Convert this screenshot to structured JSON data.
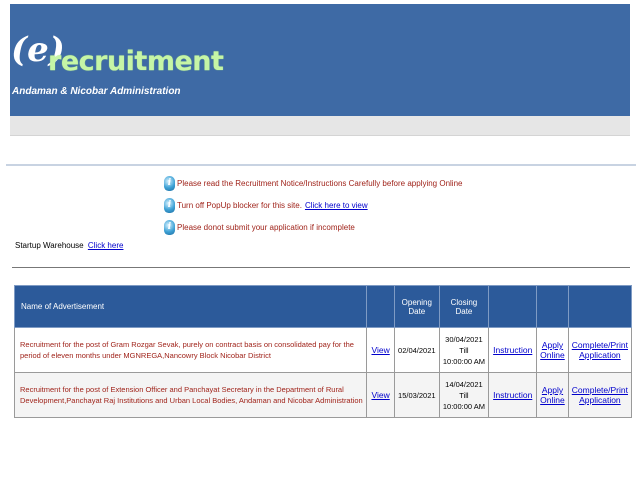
{
  "header": {
    "logo_letter": "(e)",
    "logo_word": "recruitment",
    "org_name": "Andaman & Nicobar Administration"
  },
  "notices": [
    {
      "text": "Please read the Recruitment Notice/Instructions Carefully before applying Online",
      "link": ""
    },
    {
      "text": "Turn off PopUp blocker for this site.",
      "link": "Click here to view"
    },
    {
      "text": "Please donot submit your application if incomplete",
      "link": ""
    }
  ],
  "startup": {
    "label": "Startup Warehouse",
    "link": "Click here"
  },
  "table": {
    "headers": [
      "Name of Advertisement",
      "",
      "Opening Date",
      "Closing Date",
      "",
      "",
      ""
    ],
    "rows": [
      {
        "title": "Recruitment for the post of Gram Rozgar Sevak, purely on contract basis on consolidated pay for the period of eleven months under MGNREGA,Nancowry Block Nicobar District",
        "view": "View",
        "opening": "02/04/2021",
        "closing_date": "30/04/2021 Till",
        "closing_time": "10:00:00 AM",
        "instruction": "Instruction",
        "apply_1": "Apply",
        "apply_2": "Online",
        "complete_1": "Complete/Print",
        "complete_2": "Application"
      },
      {
        "title": "Recruitment for the post of Extension Officer and Panchayat Secretary in the Department of Rural Development,Panchayat Raj Institutions and Urban Local Bodies, Andaman and Nicobar Administration",
        "view": "View",
        "opening": "15/03/2021",
        "closing_date": "14/04/2021 Till",
        "closing_time": "10:00:00 AM",
        "instruction": "Instruction",
        "apply_1": "Apply",
        "apply_2": "Online",
        "complete_1": "Complete/Print",
        "complete_2": "Application"
      }
    ]
  },
  "colors": {
    "header_bg": "#3e6aa5",
    "logo_green": "#c6f5a6",
    "notice_red": "#a0241b",
    "table_header": "#2c5a9a"
  }
}
